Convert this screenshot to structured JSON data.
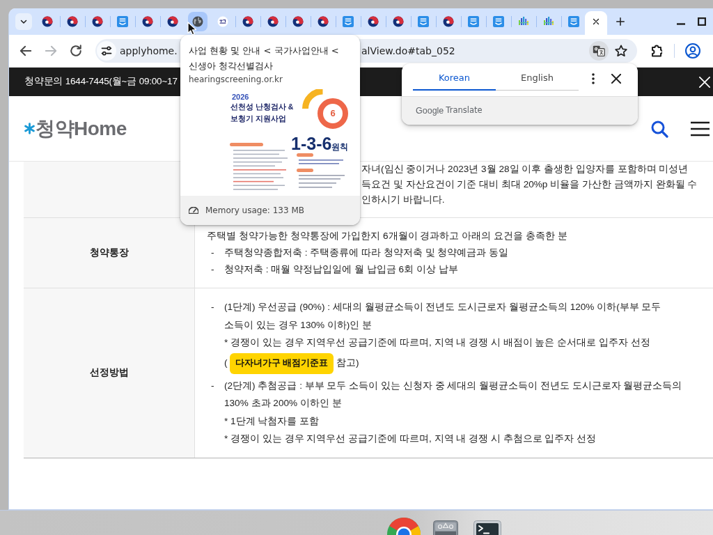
{
  "browser": {
    "tabs": [
      {
        "kind": "gov",
        "selected": false,
        "hovered": false
      },
      {
        "kind": "gov",
        "selected": false,
        "hovered": false
      },
      {
        "kind": "gov",
        "selected": false,
        "hovered": false
      },
      {
        "kind": "square",
        "selected": false,
        "hovered": false
      },
      {
        "kind": "gov",
        "selected": false,
        "hovered": false
      },
      {
        "kind": "gov",
        "selected": false,
        "hovered": false
      },
      {
        "kind": "globe",
        "selected": false,
        "hovered": true
      },
      {
        "kind": "seal",
        "selected": false,
        "hovered": false
      },
      {
        "kind": "gov",
        "selected": false,
        "hovered": false
      },
      {
        "kind": "gov",
        "selected": false,
        "hovered": false
      },
      {
        "kind": "gov",
        "selected": false,
        "hovered": false
      },
      {
        "kind": "gov",
        "selected": false,
        "hovered": false
      },
      {
        "kind": "square",
        "selected": false,
        "hovered": false
      },
      {
        "kind": "gov",
        "selected": false,
        "hovered": false
      },
      {
        "kind": "gov",
        "selected": false,
        "hovered": false
      },
      {
        "kind": "square",
        "selected": false,
        "hovered": false
      },
      {
        "kind": "gov",
        "selected": false,
        "hovered": false
      },
      {
        "kind": "square",
        "selected": false,
        "hovered": false
      },
      {
        "kind": "square",
        "selected": false,
        "hovered": false
      },
      {
        "kind": "bars",
        "selected": false,
        "hovered": false
      },
      {
        "kind": "bars",
        "selected": false,
        "hovered": false
      },
      {
        "kind": "square",
        "selected": false,
        "hovered": false
      },
      {
        "selected": true,
        "hovered": false
      }
    ],
    "nav_buttons": [
      {
        "kind": "back",
        "disabled": false
      },
      {
        "kind": "forward",
        "disabled": true
      },
      {
        "kind": "reload",
        "disabled": false
      }
    ],
    "address_bar": {
      "visible_parts": [
        "applyhome.",
        "alView.do#tab_052"
      ]
    }
  },
  "tab_hover_card": {
    "title_lines": [
      "사업 현황 및 안내 < 국가사업안내 <",
      "신생아 청각선별검사"
    ],
    "domain": "hearingscreening.or.kr",
    "preview": {
      "year": "2026",
      "title_lines": [
        "선천성 난청검사 &",
        "보청기 지원사업"
      ],
      "badge": "6",
      "motto": "1-3-6",
      "motto_suffix": "원칙"
    },
    "memory": "Memory usage: 133 MB"
  },
  "translate_popup": {
    "languages": [
      {
        "label": "Korean",
        "selected": true
      },
      {
        "label": "English",
        "selected": false
      }
    ],
    "brand": "Google",
    "label": "Translate"
  },
  "notice_bar": {
    "text": "청약문의 1644-7445(월~금 09:00~17"
  },
  "site_header": {
    "logo": "청약Home"
  },
  "table": {
    "rows": [
      {
        "content": [
          {
            "kind": "fragments",
            "lines": [
              "자녀(임신 중이거나 2023년 3월 28일 이후 출생한 입양자를 포함하며 미성년",
              "득요건 및 자산요건이 기준 대비 최대 20%p 비율을 가산한 금액까지 완화될 수",
              "인하시기 바랍니다."
            ]
          }
        ]
      },
      {
        "label": "청약통장",
        "content": [
          {
            "kind": "text",
            "text": "주택별 청약가능한 청약통장에 가입한지 6개월이 경과하고 아래의 요건을 충족한 분"
          },
          {
            "kind": "bullet",
            "marker": "-",
            "lines": [
              "주택청약종합저축 : 주택종류에 따라 청약저축 및 청약예금과 동일"
            ]
          },
          {
            "kind": "bullet",
            "marker": "-",
            "lines": [
              "청약저축 : 매월 약정납입일에 월 납입금 6회 이상 납부"
            ]
          }
        ]
      },
      {
        "label": "선정방법",
        "content": [
          {
            "kind": "bullet",
            "marker": "-",
            "lines": [
              "(1단계) 우선공급 (90%) : 세대의 월평균소득이 전년도 도시근로자 월평균소득의 120% 이하(부부 모두",
              "소득이 있는 경우 130% 이하)인 분"
            ]
          },
          {
            "kind": "note",
            "text": "* 경쟁이 있는 경우 지역우선 공급기준에 따르며, 지역 내 경쟁 시 배점이 높은 순서대로 입주자 선정"
          },
          {
            "kind": "link",
            "before": "(",
            "button": "다자녀가구 배점기준표",
            "after": "참고)"
          },
          {
            "kind": "bullet",
            "marker": "-",
            "lines": [
              "(2단계) 추첨공급 : 부부 모두 소득이 있는 신청자 중 세대의 월평균소득이 전년도 도시근로자 월평균소득의",
              "130% 초과 200% 이하인 분"
            ]
          },
          {
            "kind": "note",
            "text": "* 1단계 낙첨자를 포함"
          },
          {
            "kind": "note",
            "text": "* 경쟁이 있는 경우 지역우선 공급기준에 따르며, 지역 내 경쟁 시 추첨으로 입주자 선정"
          }
        ]
      }
    ]
  }
}
